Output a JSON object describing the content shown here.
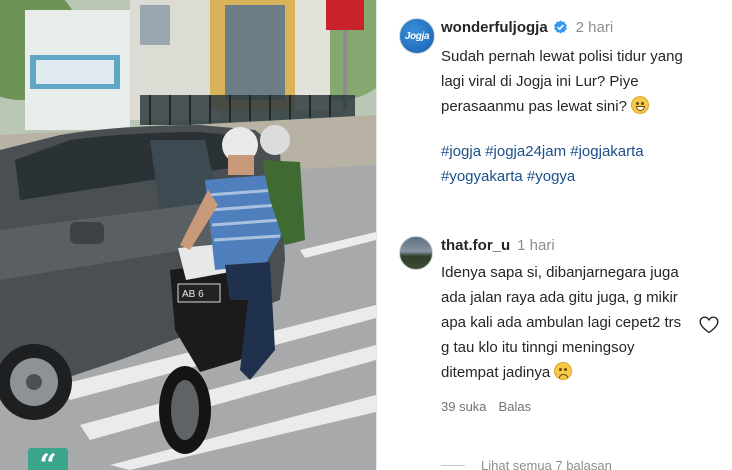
{
  "post": {
    "username": "wonderfuljogja",
    "avatar_text": "Jogja",
    "time": "2 hari",
    "caption_lines": [
      "Sudah pernah lewat polisi tidur yang",
      "lagi viral di Jogja ini Lur? Piye",
      "perasaanmu pas lewat sini?"
    ],
    "hashtag_lines": [
      "#jogja #jogja24jam #jogjakarta",
      "#yogyakarta #yogya"
    ],
    "icons": {
      "verified": "verified-badge-icon",
      "emoji": "grinning-face-icon"
    },
    "colors": {
      "verified": "#3897f0",
      "hashtag": "#1a4f8a"
    }
  },
  "comment": {
    "username": "that.for_u",
    "time": "1 hari",
    "text_lines": [
      "Idenya sapa si, dibanjarnegara juga",
      "ada jalan raya ada gitu juga, g mikir",
      "apa kali ada ambulan lagi cepet2 trs",
      "g tau klo itu tinngi meningsoy",
      "ditempat jadinya"
    ],
    "likes": "39 suka",
    "reply_label": "Balas",
    "icons": {
      "like": "heart-icon",
      "emoji": "sad-face-icon"
    }
  },
  "view_replies": "Lihat semua 7 balasan",
  "photo": {
    "sign_text": "",
    "plate": "AB 6",
    "badge_icon": "quote-icon"
  }
}
